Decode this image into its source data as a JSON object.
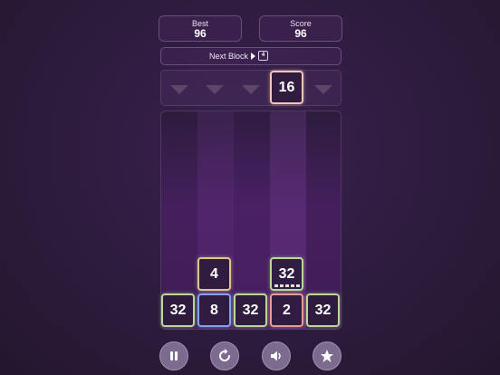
{
  "scores": {
    "best_label": "Best",
    "best_value": "96",
    "score_label": "Score",
    "score_value": "96"
  },
  "next_block": {
    "label": "Next Block",
    "value": "4"
  },
  "drop_row": {
    "selected_column": 3,
    "current_tile": {
      "value": "16",
      "color": "#f3c7b9"
    },
    "arrow_color": "#5c476a"
  },
  "board": {
    "columns": 5,
    "tiles": [
      {
        "column": 0,
        "row_from_bottom": 0,
        "value": "32",
        "color": "#b9d89a"
      },
      {
        "column": 1,
        "row_from_bottom": 0,
        "value": "8",
        "color": "#7fa4e8"
      },
      {
        "column": 2,
        "row_from_bottom": 0,
        "value": "32",
        "color": "#b9d89a"
      },
      {
        "column": 3,
        "row_from_bottom": 0,
        "value": "2",
        "color": "#e89a98"
      },
      {
        "column": 4,
        "row_from_bottom": 0,
        "value": "32",
        "color": "#b9d89a"
      },
      {
        "column": 1,
        "row_from_bottom": 1,
        "value": "4",
        "color": "#d8c98a"
      },
      {
        "column": 3,
        "row_from_bottom": 1,
        "value": "32",
        "color": "#b9d89a"
      }
    ]
  },
  "controls": [
    {
      "name": "pause-button",
      "icon": "pause-icon"
    },
    {
      "name": "restart-button",
      "icon": "restart-icon"
    },
    {
      "name": "sound-button",
      "icon": "speaker-icon"
    },
    {
      "name": "favorite-button",
      "icon": "star-icon"
    }
  ],
  "colors": {
    "background": "#2c1c3b",
    "panel_border": "#6a4f7d",
    "button_fill": "#7c6a8f"
  }
}
